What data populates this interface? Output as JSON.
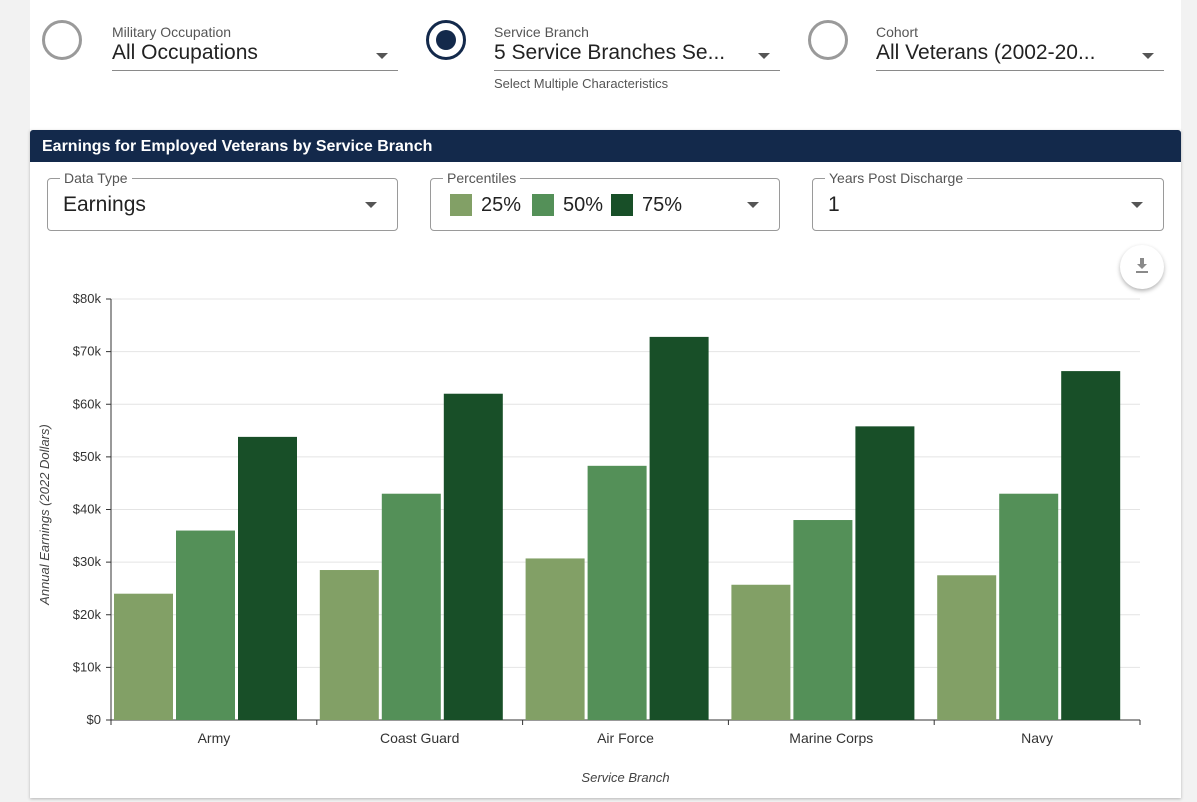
{
  "filters": {
    "occupation": {
      "label": "Military Occupation",
      "value": "All Occupations",
      "selected": false
    },
    "branch": {
      "label": "Service Branch",
      "value": "5 Service Branches Se...",
      "helper": "Select Multiple Characteristics",
      "selected": true
    },
    "cohort": {
      "label": "Cohort",
      "value": "All Veterans (2002-20...",
      "selected": false
    }
  },
  "panel": {
    "title": "Earnings for Employed Veterans by Service Branch",
    "data_type": {
      "label": "Data Type",
      "value": "Earnings"
    },
    "percentiles": {
      "label": "Percentiles",
      "items": [
        {
          "label": "25%",
          "color": "#82a066"
        },
        {
          "label": "50%",
          "color": "#549058"
        },
        {
          "label": "75%",
          "color": "#184f28"
        }
      ]
    },
    "years": {
      "label": "Years Post Discharge",
      "value": "1"
    },
    "download_icon": "download-icon"
  },
  "chart_data": {
    "type": "bar",
    "categories": [
      "Army",
      "Coast Guard",
      "Air Force",
      "Marine Corps",
      "Navy"
    ],
    "series": [
      {
        "name": "25%",
        "color": "#82a066",
        "values": [
          24000,
          28500,
          30700,
          25700,
          27500
        ]
      },
      {
        "name": "50%",
        "color": "#549058",
        "values": [
          36000,
          43000,
          48300,
          38000,
          43000
        ]
      },
      {
        "name": "75%",
        "color": "#184f28",
        "values": [
          53800,
          62000,
          72800,
          55800,
          66300
        ]
      }
    ],
    "xlabel": "Service Branch",
    "ylabel": "Annual Earnings (2022 Dollars)",
    "ylim": [
      0,
      80000
    ],
    "yticks": [
      "$0",
      "$10k",
      "$20k",
      "$30k",
      "$40k",
      "$50k",
      "$60k",
      "$70k",
      "$80k"
    ],
    "grid": true
  }
}
